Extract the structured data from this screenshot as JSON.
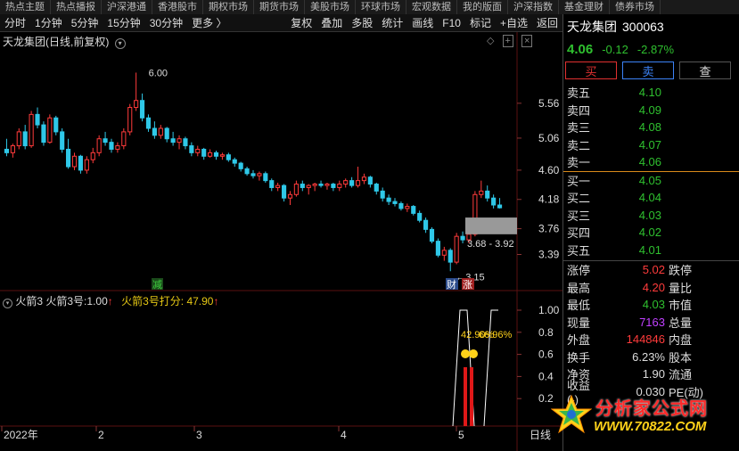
{
  "topnav": [
    "热点主题",
    "热点播报",
    "沪深港通",
    "香港股市",
    "期权市场",
    "期货市场",
    "美股市场",
    "环球市场",
    "宏观数据",
    "我的版面",
    "沪深指数",
    "基金理财",
    "债券市场"
  ],
  "toolbar": {
    "left": [
      "分时",
      "1分钟",
      "5分钟",
      "15分钟",
      "30分钟",
      "更多 〉"
    ],
    "right": [
      "复权",
      "叠加",
      "多股",
      "统计",
      "画线",
      "F10",
      "标记",
      "+自选",
      "返回"
    ]
  },
  "chart": {
    "title": "天龙集团(日线,前复权)",
    "price_axis": [
      "5.56",
      "5.06",
      "4.60",
      "4.18",
      "3.76",
      "3.39"
    ],
    "high_label": "6.00",
    "low_label": "3.15",
    "range_label": "3.68 - 3.92",
    "marks": {
      "jian": "减",
      "cai": "财",
      "zhang": "涨"
    },
    "date_axis": [
      "2022年",
      "2",
      "3",
      "4",
      "5",
      "日线"
    ],
    "colors": {
      "up": "#ff3b3b",
      "down": "#2fc8e8",
      "grid": "#5a1010"
    },
    "candles": [
      [
        4.9,
        5.05,
        4.8,
        4.85
      ],
      [
        4.85,
        4.98,
        4.78,
        4.95
      ],
      [
        4.95,
        5.2,
        4.9,
        5.15
      ],
      [
        5.15,
        5.25,
        4.9,
        4.95
      ],
      [
        4.95,
        5.45,
        4.92,
        5.4
      ],
      [
        5.4,
        5.5,
        5.2,
        5.25
      ],
      [
        5.25,
        5.3,
        4.95,
        5.0
      ],
      [
        5.0,
        5.4,
        4.98,
        5.35
      ],
      [
        5.35,
        5.38,
        5.1,
        5.15
      ],
      [
        5.15,
        5.2,
        4.85,
        4.9
      ],
      [
        4.9,
        5.05,
        4.62,
        4.65
      ],
      [
        4.65,
        4.85,
        4.6,
        4.8
      ],
      [
        4.8,
        4.82,
        4.55,
        4.6
      ],
      [
        4.6,
        4.8,
        4.55,
        4.75
      ],
      [
        4.75,
        4.92,
        4.7,
        4.85
      ],
      [
        4.85,
        5.1,
        4.8,
        5.05
      ],
      [
        5.05,
        5.15,
        4.95,
        5.0
      ],
      [
        5.0,
        5.05,
        4.85,
        4.9
      ],
      [
        4.9,
        5.0,
        4.85,
        4.95
      ],
      [
        4.95,
        5.2,
        4.9,
        5.15
      ],
      [
        5.15,
        5.55,
        5.1,
        5.5
      ],
      [
        5.5,
        6.0,
        5.45,
        5.6
      ],
      [
        5.6,
        5.7,
        5.3,
        5.35
      ],
      [
        5.35,
        5.4,
        5.15,
        5.2
      ],
      [
        5.2,
        5.3,
        5.05,
        5.1
      ],
      [
        5.1,
        5.25,
        5.05,
        5.2
      ],
      [
        5.2,
        5.22,
        5.0,
        5.05
      ],
      [
        5.05,
        5.15,
        4.95,
        5.0
      ],
      [
        5.0,
        5.1,
        4.9,
        5.05
      ],
      [
        5.05,
        5.08,
        4.9,
        4.95
      ],
      [
        4.95,
        5.0,
        4.8,
        4.85
      ],
      [
        4.85,
        4.95,
        4.8,
        4.9
      ],
      [
        4.9,
        4.92,
        4.75,
        4.8
      ],
      [
        4.8,
        4.9,
        4.78,
        4.85
      ],
      [
        4.85,
        4.88,
        4.75,
        4.8
      ],
      [
        4.8,
        4.85,
        4.75,
        4.82
      ],
      [
        4.82,
        4.85,
        4.72,
        4.75
      ],
      [
        4.75,
        4.78,
        4.65,
        4.7
      ],
      [
        4.7,
        4.72,
        4.58,
        4.62
      ],
      [
        4.62,
        4.65,
        4.52,
        4.55
      ],
      [
        4.55,
        4.6,
        4.48,
        4.52
      ],
      [
        4.52,
        4.58,
        4.45,
        4.55
      ],
      [
        4.55,
        4.58,
        4.42,
        4.45
      ],
      [
        4.45,
        4.48,
        4.3,
        4.35
      ],
      [
        4.35,
        4.42,
        4.3,
        4.38
      ],
      [
        4.38,
        4.4,
        4.15,
        4.2
      ],
      [
        4.2,
        4.3,
        4.1,
        4.25
      ],
      [
        4.25,
        4.45,
        4.22,
        4.4
      ],
      [
        4.4,
        4.45,
        4.3,
        4.35
      ],
      [
        4.35,
        4.4,
        4.25,
        4.38
      ],
      [
        4.38,
        4.42,
        4.3,
        4.4
      ],
      [
        4.4,
        4.45,
        4.35,
        4.38
      ],
      [
        4.38,
        4.42,
        4.32,
        4.4
      ],
      [
        4.4,
        4.42,
        4.3,
        4.35
      ],
      [
        4.35,
        4.45,
        4.3,
        4.4
      ],
      [
        4.4,
        4.48,
        4.35,
        4.45
      ],
      [
        4.45,
        4.5,
        4.35,
        4.38
      ],
      [
        4.38,
        4.65,
        4.35,
        4.45
      ],
      [
        4.45,
        4.55,
        4.4,
        4.5
      ],
      [
        4.5,
        4.52,
        4.35,
        4.4
      ],
      [
        4.4,
        4.42,
        4.25,
        4.3
      ],
      [
        4.3,
        4.35,
        4.15,
        4.2
      ],
      [
        4.2,
        4.25,
        4.1,
        4.15
      ],
      [
        4.15,
        4.2,
        4.08,
        4.12
      ],
      [
        4.12,
        4.15,
        4.02,
        4.05
      ],
      [
        4.05,
        4.12,
        4.0,
        4.08
      ],
      [
        4.08,
        4.1,
        3.95,
        3.98
      ],
      [
        3.98,
        4.02,
        3.85,
        3.88
      ],
      [
        3.88,
        3.92,
        3.7,
        3.75
      ],
      [
        3.75,
        3.78,
        3.55,
        3.58
      ],
      [
        3.58,
        3.62,
        3.35,
        3.38
      ],
      [
        3.38,
        3.5,
        3.3,
        3.45
      ],
      [
        3.45,
        3.48,
        3.15,
        3.28
      ],
      [
        3.28,
        3.7,
        3.25,
        3.65
      ],
      [
        3.65,
        3.72,
        3.55,
        3.6
      ],
      [
        3.6,
        3.7,
        3.55,
        3.68
      ],
      [
        3.68,
        4.3,
        3.65,
        4.25
      ],
      [
        4.25,
        4.45,
        4.2,
        4.3
      ],
      [
        4.3,
        4.38,
        4.15,
        4.2
      ],
      [
        4.2,
        4.25,
        4.05,
        4.1
      ],
      [
        4.1,
        4.2,
        4.05,
        4.06
      ]
    ]
  },
  "indicator": {
    "name": "火箭3",
    "line1_label": "火箭3号:",
    "line1_value": "1.00",
    "line2_label": "火箭3号打分:",
    "line2_value": "47.90",
    "arrow": "↑",
    "axis": [
      "1.00",
      "0.8",
      "0.6",
      "0.4",
      "0.2"
    ],
    "overlay_text": "42.90%",
    "overlay_text2": "66.96%"
  },
  "stock": {
    "name": "天龙集团",
    "code": "300063",
    "price": "4.06",
    "change": "-0.12",
    "pct": "-2.87%",
    "buy": "买",
    "sell": "卖",
    "check": "查"
  },
  "orderbook": {
    "asks": [
      [
        "卖五",
        "4.10"
      ],
      [
        "卖四",
        "4.09"
      ],
      [
        "卖三",
        "4.08"
      ],
      [
        "卖二",
        "4.07"
      ],
      [
        "卖一",
        "4.06"
      ]
    ],
    "bids": [
      [
        "买一",
        "4.05"
      ],
      [
        "买二",
        "4.04"
      ],
      [
        "买三",
        "4.03"
      ],
      [
        "买四",
        "4.02"
      ],
      [
        "买五",
        "4.01"
      ]
    ]
  },
  "stats": [
    {
      "l1": "涨停",
      "v1": "5.02",
      "c1": "red",
      "l2": "跌停",
      "v2": ""
    },
    {
      "l1": "最高",
      "v1": "4.20",
      "c1": "red",
      "l2": "量比",
      "v2": ""
    },
    {
      "l1": "最低",
      "v1": "4.03",
      "c1": "green",
      "l2": "市值",
      "v2": ""
    },
    {
      "l1": "现量",
      "v1": "7163",
      "c1": "purple",
      "l2": "总量",
      "v2": ""
    },
    {
      "l1": "外盘",
      "v1": "144846",
      "c1": "red",
      "l2": "内盘",
      "v2": ""
    },
    {
      "l1": "换手",
      "v1": "6.23%",
      "c1": "white",
      "l2": "股本",
      "v2": ""
    },
    {
      "l1": "净资",
      "v1": "1.90",
      "c1": "white",
      "l2": "流通",
      "v2": ""
    },
    {
      "l1": "收益(-)",
      "v1": "0.030",
      "c1": "white",
      "l2": "PE(动)",
      "v2": ""
    }
  ],
  "logo": {
    "line1": "分析家公式网",
    "line2": "WWW.70822.COM"
  }
}
